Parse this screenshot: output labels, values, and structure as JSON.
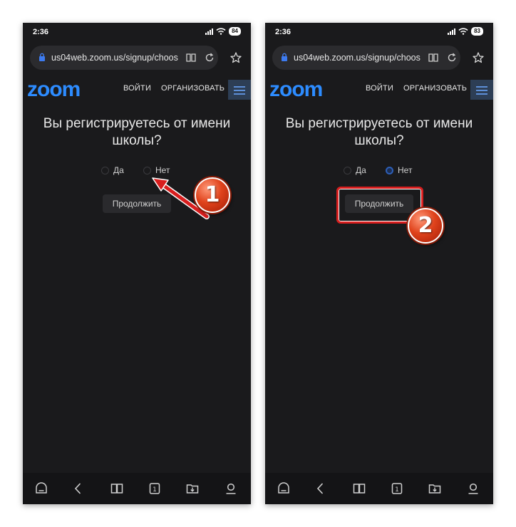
{
  "status": {
    "time": "2:36",
    "battery_left": "84",
    "battery_right": "83"
  },
  "browser": {
    "url": "us04web.zoom.us/signup/choos"
  },
  "site": {
    "logo": "zoom",
    "nav_login": "ВОЙТИ",
    "nav_organize": "ОРГАНИЗОВАТЬ"
  },
  "form": {
    "question": "Вы регистрируетесь от имени школы?",
    "option_yes": "Да",
    "option_no": "Нет",
    "continue_label": "Продолжить"
  },
  "screens": {
    "left": {
      "selected_option": "none"
    },
    "right": {
      "selected_option": "Нет"
    }
  },
  "annotations": {
    "step1": "1",
    "step2": "2"
  },
  "icons": {
    "statusbar": [
      "signal-icon",
      "wifi-icon",
      "battery-icon"
    ],
    "urlbar": [
      "lock-icon",
      "reader-mode-icon",
      "reload-icon"
    ],
    "toolbar": [
      "star-icon"
    ],
    "navbar": [
      "home-icon",
      "back-icon",
      "bookmarks-icon",
      "tabs-icon",
      "downloads-icon",
      "profile-icon"
    ]
  },
  "colors": {
    "page_bg": "#1a1a1c",
    "zoom_blue": "#2d8cff",
    "radio_selected": "#2d5fb8",
    "annotation_red": "#d81e1e"
  }
}
